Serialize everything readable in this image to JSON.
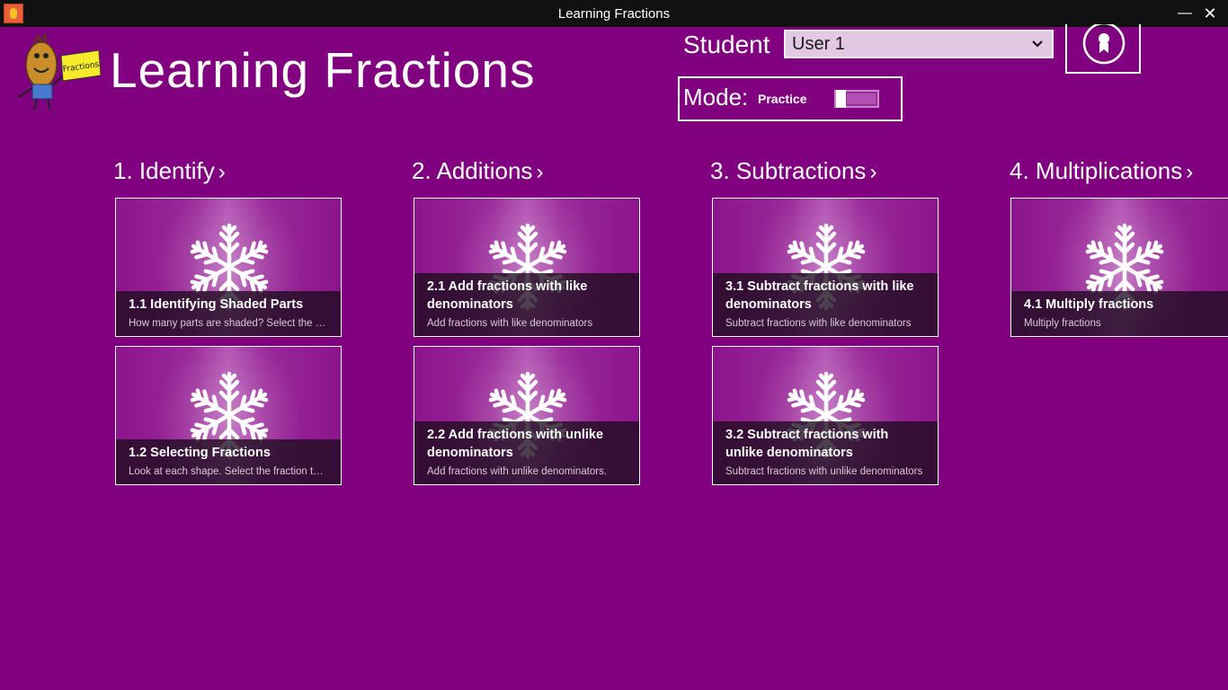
{
  "window": {
    "title": "Learning Fractions",
    "minimize_glyph": "—",
    "close_glyph": "✕"
  },
  "app": {
    "title": "Learning Fractions",
    "mascot_sign": "Fractions"
  },
  "student": {
    "label": "Student",
    "selected": "User 1"
  },
  "mode": {
    "label": "Mode:",
    "value": "Practice",
    "toggle_on": false
  },
  "colors": {
    "background": "#800080",
    "titlebar": "#111111",
    "accent": "#ffffff"
  },
  "icons": {
    "award": "award-ribbon-icon",
    "chevron": "chevron-right-icon",
    "dropdown": "chevron-down-icon",
    "tile_image": "snowflake-icon"
  },
  "groups": [
    {
      "header": "1. Identify",
      "chevron": "›",
      "tiles": [
        {
          "title": "1.1 Identifying Shaded Parts",
          "desc": "How many parts are shaded? Select the fraction that represents the shaded part"
        },
        {
          "title": "1.2 Selecting Fractions",
          "desc": "Look at each shape. Select the fraction that names the shaded part"
        }
      ]
    },
    {
      "header": "2. Additions",
      "chevron": "›",
      "tiles": [
        {
          "title": "2.1 Add  fractions with like denominators",
          "desc": "Add  fractions with like denominators"
        },
        {
          "title": "2.2 Add fractions with unlike denominators",
          "desc": "Add fractions with unlike denominators."
        }
      ]
    },
    {
      "header": "3. Subtractions",
      "chevron": "›",
      "tiles": [
        {
          "title": "3.1 Subtract  fractions with like denominators",
          "desc": "Subtract  fractions with like denominators"
        },
        {
          "title": "3.2 Subtract fractions with unlike denominators",
          "desc": "Subtract fractions with unlike denominators"
        }
      ]
    },
    {
      "header": "4. Multiplications",
      "chevron": "›",
      "tiles": [
        {
          "title": "4.1 Multiply fractions",
          "desc": "Multiply  fractions"
        }
      ]
    }
  ]
}
